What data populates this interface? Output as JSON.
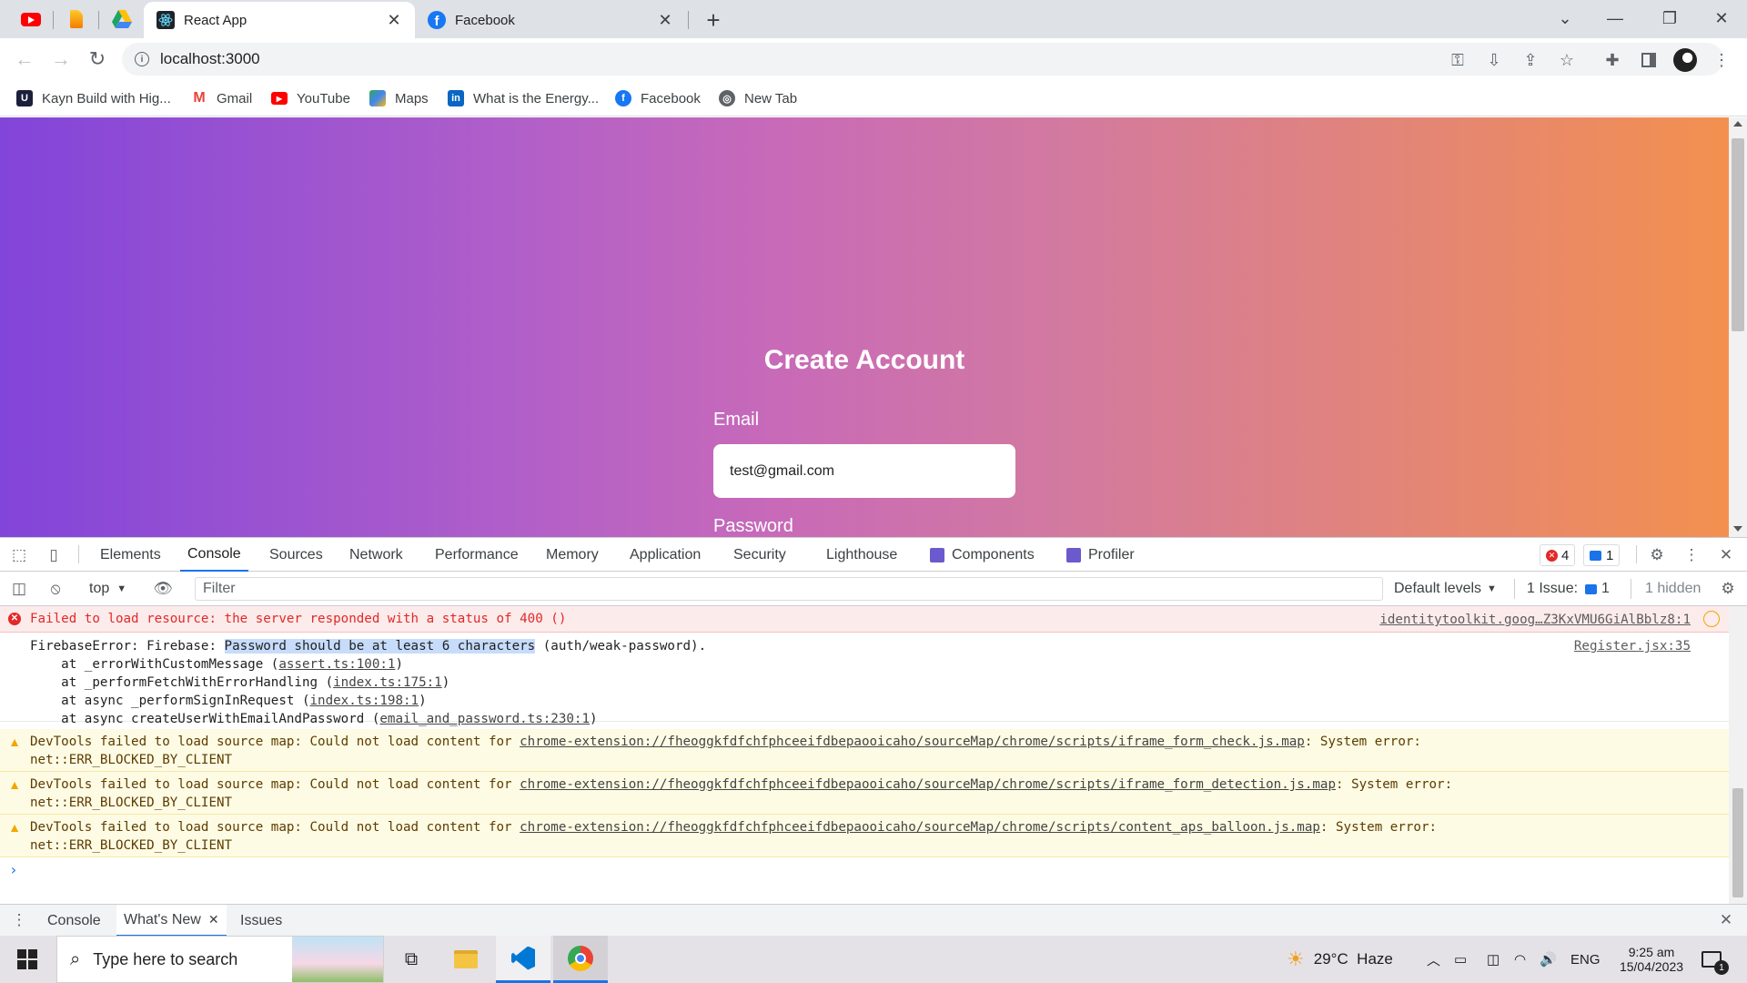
{
  "browser": {
    "tabs": [
      {
        "title": "React App",
        "active": true
      },
      {
        "title": "Facebook",
        "active": false
      }
    ],
    "url": "localhost:3000",
    "bookmarks": [
      {
        "label": "Kayn Build with Hig...",
        "icon": "kayn-icon"
      },
      {
        "label": "Gmail",
        "icon": "gmail-icon"
      },
      {
        "label": "YouTube",
        "icon": "youtube-icon"
      },
      {
        "label": "Maps",
        "icon": "maps-icon"
      },
      {
        "label": "What is the Energy...",
        "icon": "linkedin-icon"
      },
      {
        "label": "Facebook",
        "icon": "facebook-icon"
      },
      {
        "label": "New Tab",
        "icon": "newtab-icon"
      }
    ]
  },
  "page": {
    "heading": "Create Account",
    "email_label": "Email",
    "email_value": "test@gmail.com",
    "password_label": "Password"
  },
  "devtools": {
    "tabs": [
      "Elements",
      "Console",
      "Sources",
      "Network",
      "Performance",
      "Memory",
      "Application",
      "Security",
      "Lighthouse",
      "Components",
      "Profiler"
    ],
    "active_tab": "Console",
    "error_count": "4",
    "message_count": "1",
    "console_toolbar": {
      "context": "top",
      "filter_placeholder": "Filter",
      "levels": "Default levels",
      "issues_label": "1 Issue:",
      "issues_count": "1",
      "hidden": "1 hidden"
    },
    "messages": {
      "error1": {
        "text": "Failed to load resource: the server responded with a status of 400 ()",
        "source": "identitytoolkit.goog…Z3KxVMU6GiAlBblz8:1"
      },
      "firebase": {
        "prefix": "FirebaseError: Firebase: ",
        "highlight": "Password should be at least 6 characters",
        "suffix": " (auth/weak-password).",
        "source": "Register.jsx:35",
        "stack": [
          {
            "text": "    at _errorWithCustomMessage (",
            "link": "assert.ts:100:1",
            "end": ")"
          },
          {
            "text": "    at _performFetchWithErrorHandling (",
            "link": "index.ts:175:1",
            "end": ")"
          },
          {
            "text": "    at async _performSignInRequest (",
            "link": "index.ts:198:1",
            "end": ")"
          },
          {
            "text": "    at async createUserWithEmailAndPassword (",
            "link": "email_and_password.ts:230:1",
            "end": ")"
          }
        ]
      },
      "warnings": [
        {
          "text": "DevTools failed to load source map: Could not load content for ",
          "link": "chrome-extension://fheoggkfdfchfphceeifdbepaooicaho/sourceMap/chrome/scripts/iframe_form_check.js.map",
          "end": ": System error:",
          "line2": "net::ERR_BLOCKED_BY_CLIENT"
        },
        {
          "text": "DevTools failed to load source map: Could not load content for ",
          "link": "chrome-extension://fheoggkfdfchfphceeifdbepaooicaho/sourceMap/chrome/scripts/iframe_form_detection.js.map",
          "end": ": System error:",
          "line2": "net::ERR_BLOCKED_BY_CLIENT"
        },
        {
          "text": "DevTools failed to load source map: Could not load content for ",
          "link": "chrome-extension://fheoggkfdfchfphceeifdbepaooicaho/sourceMap/chrome/scripts/content_aps_balloon.js.map",
          "end": ": System error:",
          "line2": "net::ERR_BLOCKED_BY_CLIENT"
        }
      ]
    },
    "drawer_tabs": [
      "Console",
      "What's New",
      "Issues"
    ]
  },
  "taskbar": {
    "search_placeholder": "Type here to search",
    "weather": "29°C  Haze",
    "lang": "ENG",
    "time": "9:25 am",
    "date": "15/04/2023",
    "notif_count": "1"
  },
  "colors": {
    "accent": "#1a73e8",
    "error": "#e32828",
    "warning": "#f2a600",
    "gradient_start": "#8245d9",
    "gradient_end": "#f3904f"
  }
}
